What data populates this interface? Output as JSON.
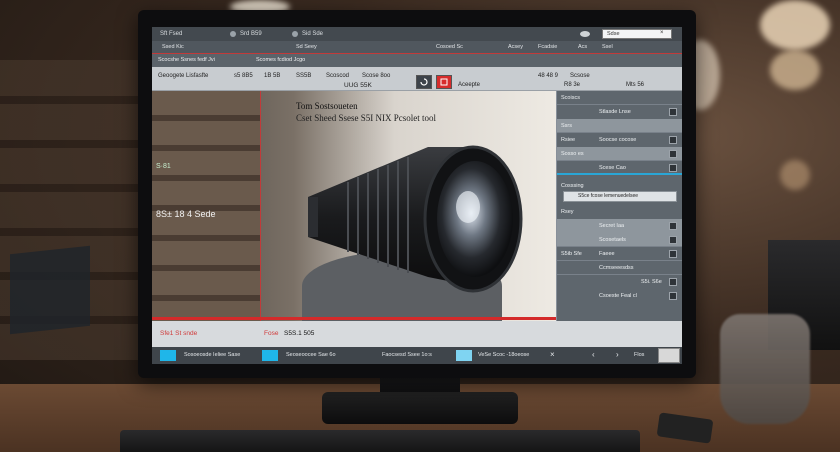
{
  "titlebar": {
    "left": "Sft Fsed",
    "mid1": "Srd B59",
    "mid2": "Sid Sde",
    "search": "Sdse",
    "close": "×"
  },
  "menubar": {
    "items": [
      "Ssed Kic",
      "Sd Seey",
      "Cosoed Sc",
      "Acsey",
      "Fcadsie",
      "Acs",
      "Ssel"
    ]
  },
  "row2": {
    "items": [
      "Scocshe Ssnes fedf Jvi",
      "Scomes fcdiod Jcgo"
    ]
  },
  "header": {
    "title": "Geoogete Lisfasfte",
    "sub1": "s5 8B5",
    "sub2": "1B 5B",
    "sub3": "SS5B",
    "sub4": "Scoscod",
    "sub5": "Scose 8oo",
    "right1": "48 48 9",
    "right2": "Scsose",
    "price": "UUG 55K",
    "accept": "Aceepte",
    "col1": "R8 3e",
    "col2": "Mts 56"
  },
  "viewer": {
    "title": "Tom Sostsoueten",
    "subtitle": "Cset Sheed Ssese S5I NIX Pcsolet tool",
    "label1": "S·81",
    "label2": "8S± 18 4 Sede"
  },
  "panel": {
    "rows": [
      {
        "label": "Scoiscs",
        "value": ""
      },
      {
        "label": "",
        "value": "Stlasde Lnse"
      },
      {
        "label": "Ssrs",
        "value": ""
      },
      {
        "label": "Rsiee",
        "value": "Soocse cocose"
      },
      {
        "label": "Sosso es",
        "value": ""
      },
      {
        "label": "",
        "value": "Scese Cao"
      },
      {
        "label": "Cosssing",
        "value": ""
      },
      {
        "label": "",
        "value": "S5ce fcose lemenuedelsee"
      },
      {
        "label": "Rsey",
        "value": ""
      },
      {
        "label": "",
        "value": "Secret Iaa"
      },
      {
        "label": "",
        "value": "Scosetaels"
      },
      {
        "label": "S5ib Sfe",
        "value": "Faeee"
      },
      {
        "label": "",
        "value": "Ccmseeesdss"
      },
      {
        "label": "",
        "value": "S5i. S6e"
      },
      {
        "label": "",
        "value": "Csoeste Feal cl"
      }
    ]
  },
  "bottom": {
    "left": "Sfe1 St snde",
    "price_label": "Fose",
    "price": "S5S.1 505"
  },
  "statusbar": {
    "items": [
      "Sosoeosde Ieliee Sase",
      "Seoseoocee Sae 6o",
      "Faocsesd Ssee 1o:s",
      "VeSe Scoc -18oeose",
      "Flos"
    ],
    "icons": [
      "tile-icon",
      "tile-icon",
      "tile-icon"
    ]
  },
  "colors": {
    "accent_red": "#d62c2c",
    "accent_blue": "#1fb6e9"
  }
}
